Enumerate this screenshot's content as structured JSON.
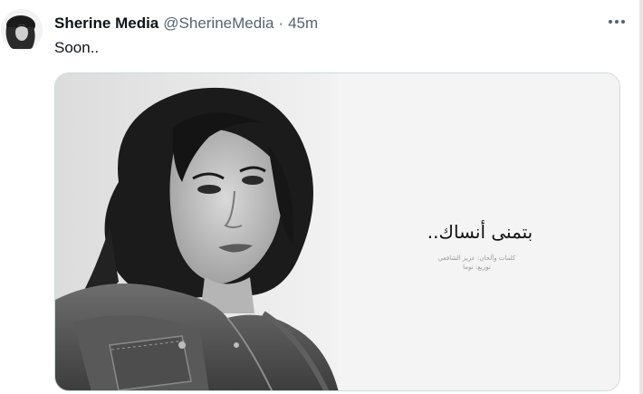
{
  "tweet": {
    "display_name": "Sherine Media",
    "handle": "@SherineMedia",
    "separator": "·",
    "time": "45m",
    "text": "Soon.."
  },
  "media": {
    "song_title": "بتمنى أنساك..",
    "credits_line1": "كلمات وألحان: عزيز الشافعي",
    "credits_line2": "توزيع: توما"
  },
  "icons": {
    "more": "more-horizontal-icon",
    "avatar": "avatar"
  },
  "colors": {
    "text_primary": "#0f1419",
    "text_secondary": "#536471",
    "border": "#cfd9de"
  }
}
